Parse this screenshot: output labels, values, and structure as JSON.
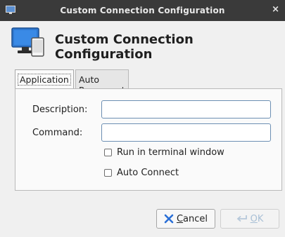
{
  "window": {
    "title": "Custom Connection Configuration",
    "close_glyph": "×"
  },
  "header": {
    "heading": "Custom Connection Configuration",
    "icon": "monitor-tablet-icon"
  },
  "tabs": [
    {
      "label": "Application",
      "active": true
    },
    {
      "label": "Auto Reconnect",
      "active": false
    }
  ],
  "form": {
    "description_label": "Description:",
    "description_value": "",
    "command_label": "Command:",
    "command_value": "",
    "run_in_terminal_label": "Run in terminal window",
    "run_in_terminal_checked": false,
    "auto_connect_label": "Auto Connect",
    "auto_connect_checked": false
  },
  "buttons": {
    "cancel_mnemonic": "C",
    "cancel_rest": "ancel",
    "ok_mnemonic": "O",
    "ok_rest": "K",
    "ok_enabled": false
  },
  "colors": {
    "titlebar": "#3a3a3a",
    "input_border": "#6c8fb3",
    "cancel_icon": "#2a6fd6"
  }
}
